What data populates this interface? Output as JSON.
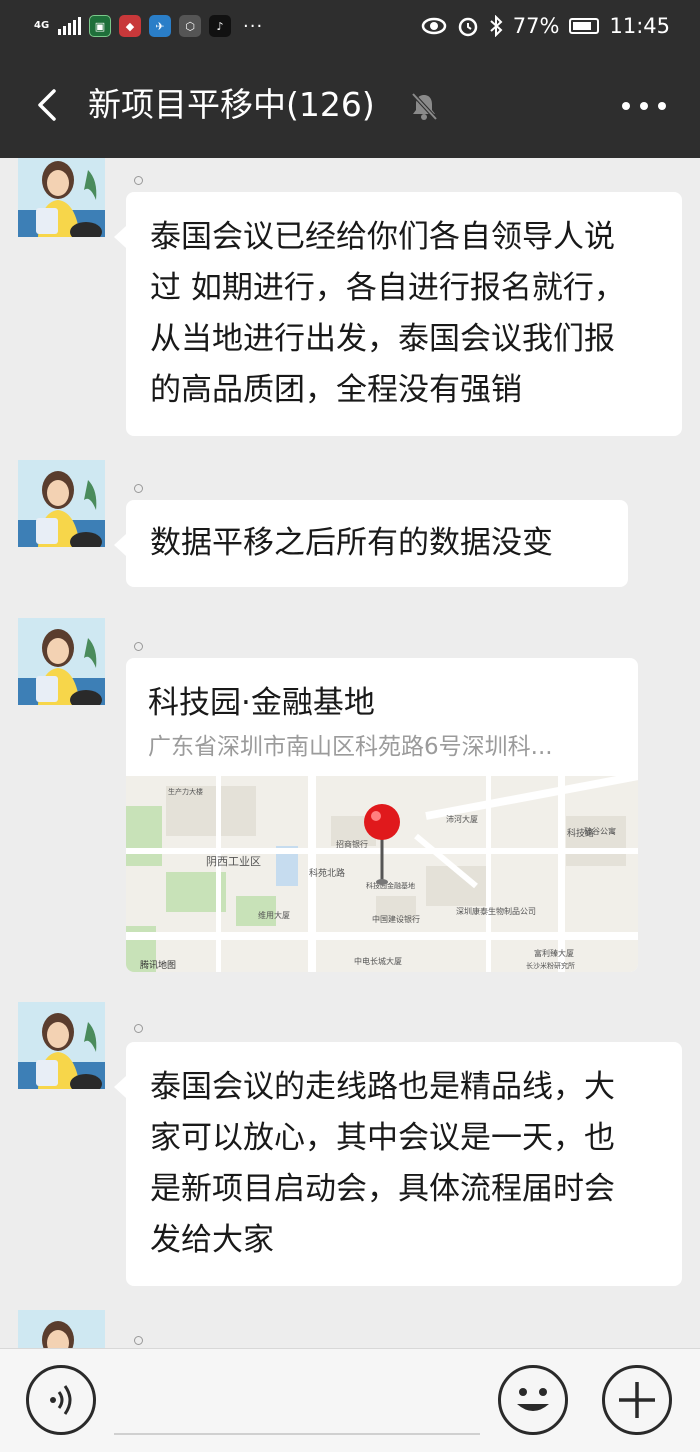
{
  "status_bar": {
    "network": "4G",
    "battery": "77%",
    "time": "11:45",
    "bg_color": "#2e2e2e"
  },
  "header": {
    "title": "新项目平移中(126)",
    "icons": [
      "back-arrow-icon",
      "mute-bell-icon",
      "more-icon"
    ]
  },
  "messages": [
    {
      "type": "text",
      "lines": [
        "泰国会议已经给你们各自领导人说",
        "过 如期进行，各自进行报名就行，",
        "从当地进行出发，泰国会议我们报",
        "的高品质团，全程没有强销"
      ]
    },
    {
      "type": "text",
      "lines": [
        "数据平移之后所有的数据没变"
      ]
    },
    {
      "type": "location",
      "name": "科技园·金融基地",
      "address": "广东省深圳市南山区科苑路6号深圳科...",
      "map": {
        "provider": "腾讯地图",
        "labels": {
          "industrial_area": "阴西工业区",
          "bank1": "招商银行",
          "bank2": "中国建设银行",
          "road1": "科苑北路",
          "road2": "科技路",
          "building1": "维用大厦",
          "building2": "中电长城大厦",
          "building3": "深圳康泰生物制品公司",
          "building4": "富利臻大厦",
          "building5": "沛河大厦",
          "building6": "硅谷公寓",
          "poi": "科技园金融基地",
          "institute": "长沙米粉研究所",
          "top_label": "生产力大楼"
        },
        "accent_color": "#e0191c"
      }
    },
    {
      "type": "text",
      "lines": [
        "泰国会议的走线路也是精品线，大",
        "家可以放心，其中会议是一天，也",
        "是新项目启动会，具体流程届时会",
        "发给大家"
      ]
    }
  ],
  "input_bar": {
    "icons": [
      "voice-icon",
      "emoji-icon",
      "plus-icon"
    ]
  }
}
